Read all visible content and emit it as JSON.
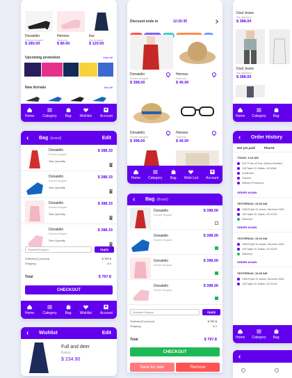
{
  "colors": {
    "accent": "#6200ee",
    "green": "#1db954",
    "red": "#ff5252"
  },
  "nav": [
    "Home",
    "Category",
    "Bag",
    "Wishlist",
    "Account"
  ],
  "nav2": [
    "Home",
    "Category",
    "Bag",
    "Wish List",
    "Account"
  ],
  "left": {
    "products": [
      {
        "name": "Donatello",
        "sub": "Dream elegant",
        "price": "$ 280.00"
      },
      {
        "name": "Hermes",
        "sub": "Glamour",
        "price": "$ 80.00"
      },
      {
        "name": "Ilse",
        "sub": "Ilse elegant",
        "price": "$ 120.00"
      }
    ],
    "upcoming": "Upcoming promotion",
    "view_all": "View all",
    "new_arrivals": "New Arrivals",
    "see_all": "See All",
    "bag_title": "Bag",
    "bag_sub": "(brand)",
    "edit": "Edit",
    "bag_items": [
      {
        "name": "Donatello",
        "sub": "Dream elegant",
        "price": "$ 388.33",
        "size": "Size",
        "qty": "Quantity"
      },
      {
        "name": "Donatello",
        "sub": "Dream elegant",
        "price": "$ 388.33",
        "size": "Size",
        "qty": "Quantity"
      },
      {
        "name": "Donatello",
        "sub": "Dream elegant",
        "price": "$ 388.33",
        "size": "Size",
        "qty": "Quantity"
      },
      {
        "name": "Donatello",
        "sub": "Dream elegant",
        "price": "$ 388.33",
        "size": "Size",
        "qty": "Quantity"
      }
    ],
    "coupon_placeholder": "Voucher/Coupon",
    "apply": "Apply",
    "subtotal_label": "Subtotal (3 product)",
    "subtotal": "$ 797.8",
    "shipping_label": "Shipping",
    "shipping": "$ 0",
    "total_label": "Total",
    "total": "$ 797.8",
    "checkout": "CHECKOUT",
    "wishlist_title": "Wishlist",
    "wish_name": "Full and deer",
    "wish_sub": "Fancy",
    "wish_price": "$ 234.90"
  },
  "mid": {
    "discount": "Discount ends in",
    "timer": "12:20:35",
    "chips": [
      {
        "label": "Shoes",
        "color": "#ff5252"
      },
      {
        "label": "High Heels",
        "color": "#7b61ff"
      },
      {
        "label": "Dress",
        "color": "#3ecbd1"
      },
      {
        "label": "Hats & Accessories",
        "color": "#ff8a50"
      },
      {
        "label": "Wat",
        "color": "#6f9bff"
      }
    ],
    "products": [
      {
        "name": "Donatello",
        "sub": "Dream elegant",
        "price": "$ 398.00"
      },
      {
        "name": "Hermes",
        "sub": "Glamour",
        "price": "$ 40.00"
      },
      {
        "name": "Donatello",
        "sub": "Dream elegant",
        "price": "$ 398.00"
      },
      {
        "name": "Hermes",
        "sub": "Glamour",
        "price": "$ 40.00"
      }
    ],
    "bag_title": "Bag",
    "bag_sub": "(Brand)",
    "bag_items": [
      {
        "name": "Donatello",
        "sub": "Dream elegant",
        "price": "$ 398.00"
      },
      {
        "name": "Donatello",
        "sub": "Dream elegant",
        "price": "$ 398.00"
      },
      {
        "name": "Donatello",
        "sub": "Dream elegant",
        "price": "$ 398.00"
      },
      {
        "name": "Donatello",
        "sub": "Dream elegant",
        "price": "$ 398.00"
      }
    ],
    "coupon_placeholder": "Voucher/Coupon",
    "apply": "Apply",
    "subtotal_label": "Subtotal (3 product)",
    "subtotal": "$ 797.8",
    "shipping_label": "Shipping",
    "shipping": "$ 0",
    "total_label": "Total",
    "total": "$ 797.8",
    "checkout": "CHECKOUT",
    "save_later": "Save for later",
    "remove": "Remove"
  },
  "right": {
    "products": [
      {
        "name": "Dust Jeans",
        "sub": "Ilse glamour",
        "price": "$ 388.00"
      },
      {
        "name": "Dust Jeans",
        "sub": "Ilse glamour",
        "price": "$ 388.00"
      }
    ],
    "order_title": "Order History",
    "col1": "Not yet paid",
    "col2": "Placed",
    "groups": [
      {
        "day": "TODAY, 3:13 AM",
        "lines": [
          "SCF Pt No.12 Rue, Athens #Verified",
          "128 Tayler St. Dallas, US #Dd6",
          "Confirmed",
          "Tracked",
          "Delivery Processed"
        ],
        "link": "ORDER AGAIN"
      },
      {
        "day": "YESTERDAY, 10:03 AM",
        "lines": [
          "1398 Pryde St, Austin, Tarrenton 3281",
          "128 Tayler St. Dallas, US 41201",
          "Delivered"
        ],
        "link": "ORDER AGAIN"
      },
      {
        "day": "YESTERDAY, 10:03 AM",
        "lines": [
          "1398 Pryde St, Austin, Tarrenton 3281",
          "128 Tayler St. Dallas, US 41201",
          "Delivered"
        ],
        "link": "ORDER AGAIN"
      },
      {
        "day": "YESTERDAY, 10:03 AM",
        "lines": [
          "1398 Pryde St, Austin, Tarrenton 3281",
          "128 Tayler St. Dallas, US 41201"
        ],
        "link": ""
      }
    ]
  }
}
